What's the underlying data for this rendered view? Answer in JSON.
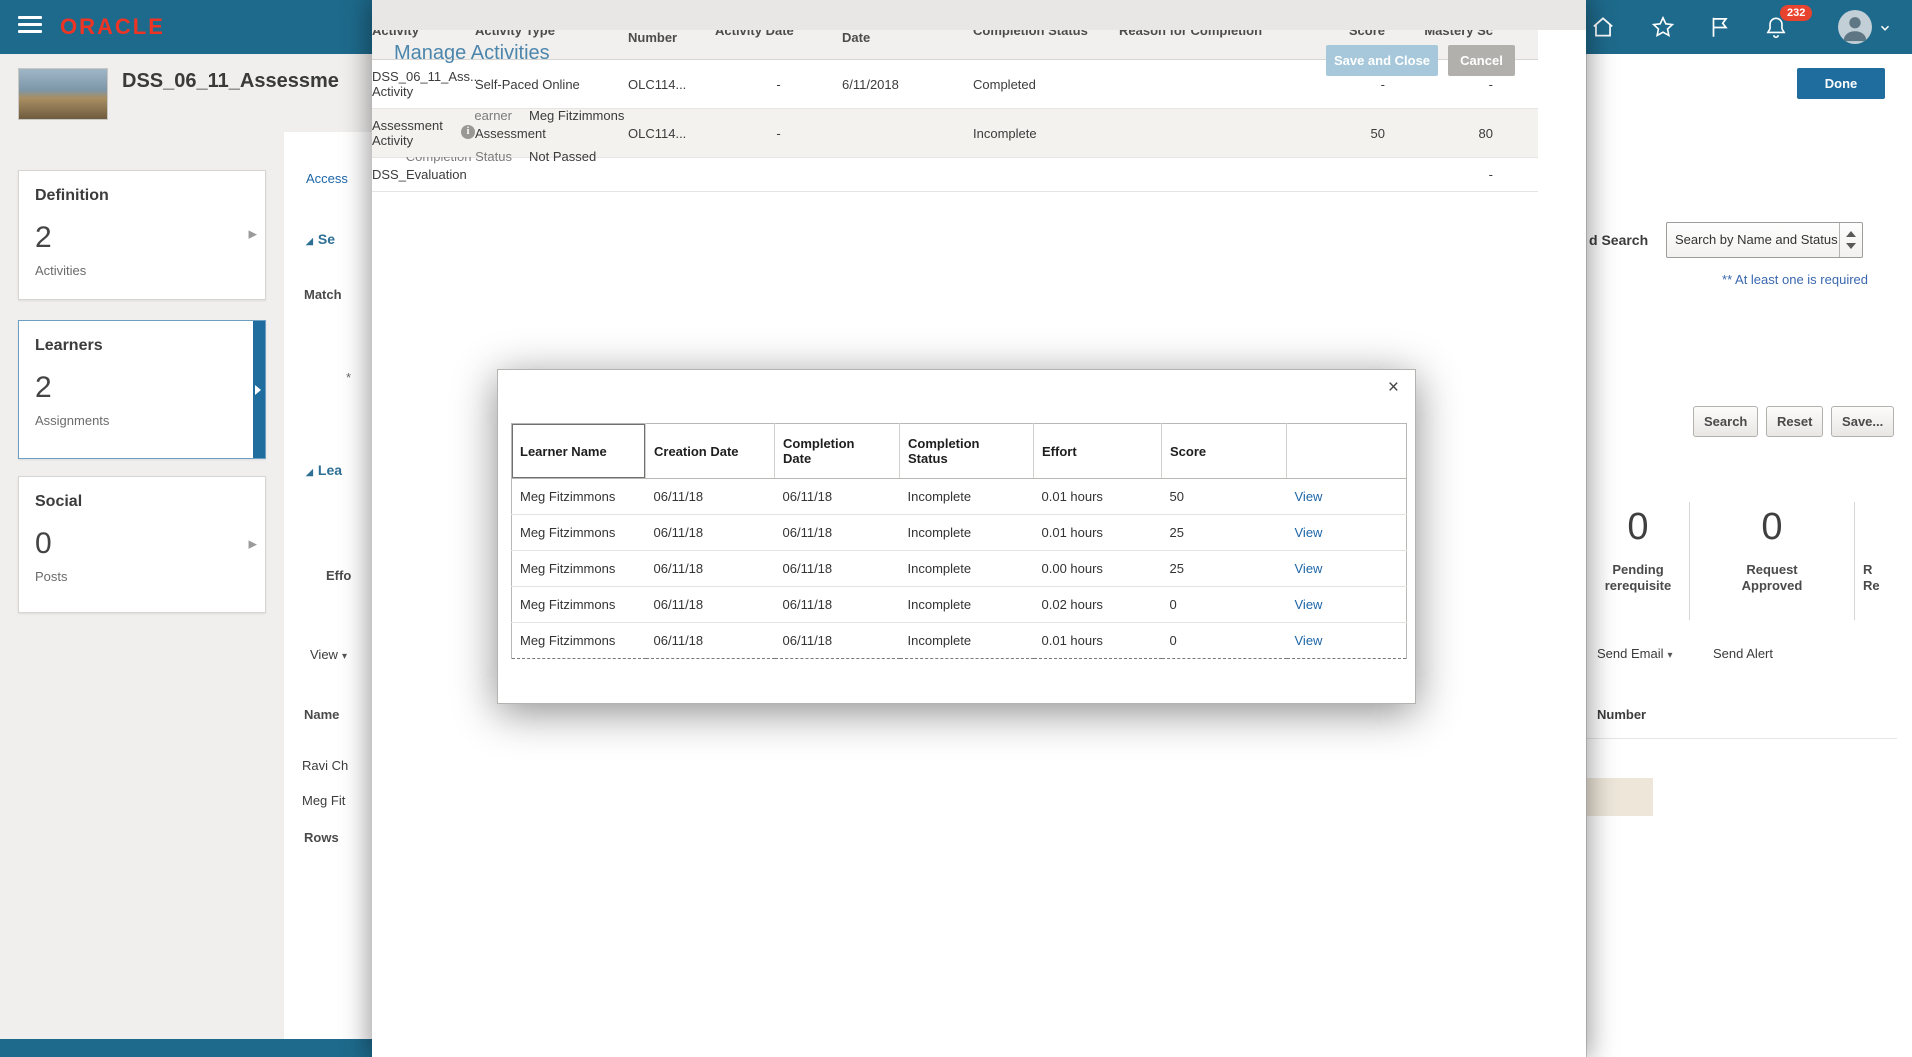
{
  "colors": {
    "topbar": "#1e6a8c",
    "brand_red": "#ee3424",
    "accent_blue": "#1e6d9e",
    "link_blue": "#1d66a7",
    "section_blue": "#2e6f94",
    "title_blue": "#4c86ac",
    "note_blue": "#3a68ad",
    "badge_red": "#e8432e",
    "save_disabled": "#a6c8da",
    "cancel_gray": "#b2b0ac"
  },
  "topbar": {
    "brand": "ORACLE",
    "badge_count": "232"
  },
  "page": {
    "title": "DSS_06_11_Assessme",
    "cards": [
      {
        "title": "Definition",
        "count": "2",
        "sublabel": "Activities"
      },
      {
        "title": "Learners",
        "count": "2",
        "sublabel": "Assignments"
      },
      {
        "title": "Social",
        "count": "0",
        "sublabel": "Posts"
      }
    ],
    "clipped": {
      "access": "Access",
      "section_a": "Se",
      "match": "Match",
      "asterisk": "*",
      "section_b": "Lea",
      "effort": "Effo",
      "view": "View",
      "name": "Name",
      "person_1": "Ravi Ch",
      "person_2": "Meg Fit",
      "rows": "Rows"
    }
  },
  "overlay": {
    "title": "Manage Activities",
    "save_button": "Save and Close",
    "cancel_button": "Cancel",
    "learner_label": "Learner",
    "learner_value": "Meg Fitzimmons",
    "status_label": "Completion Status",
    "status_value": "Not Passed",
    "table": {
      "columns": [
        "Activity",
        "Activity Type",
        "Activity Number",
        "Activity Date",
        "Completion Date",
        "Completion Status",
        "Reason for Completion",
        "Score",
        "Mastery Sc"
      ],
      "rows": [
        {
          "activity": [
            "DSS_06_11_Ass...",
            "Activity"
          ],
          "type": "Self-Paced Online",
          "number": "OLC114...",
          "activity_date": "-",
          "completion_date": "6/11/2018",
          "status": "Completed",
          "reason": "",
          "score": "-",
          "mastery": "-"
        },
        {
          "activity": [
            "Assessment",
            "Activity"
          ],
          "type": "Assessment",
          "number": "OLC114...",
          "activity_date": "-",
          "completion_date": "",
          "status": "Incomplete",
          "reason": "",
          "score": "50",
          "mastery": "80"
        },
        {
          "activity": [
            "DSS_Evaluation",
            ""
          ],
          "type": "",
          "number": "",
          "activity_date": "",
          "completion_date": "",
          "status": "",
          "reason": "",
          "score": "",
          "mastery": "-"
        }
      ]
    }
  },
  "modal": {
    "close_icon": "×",
    "table": {
      "columns": [
        "Learner Name",
        "Creation Date",
        "Completion Date",
        "Completion Status",
        "Effort",
        "Score"
      ],
      "rows": [
        {
          "learner": "Meg Fitzimmons",
          "creation": "06/11/18",
          "completion": "06/11/18",
          "status": "Incomplete",
          "effort": "0.01 hours",
          "score": "50",
          "action": "View"
        },
        {
          "learner": "Meg Fitzimmons",
          "creation": "06/11/18",
          "completion": "06/11/18",
          "status": "Incomplete",
          "effort": "0.01 hours",
          "score": "25",
          "action": "View"
        },
        {
          "learner": "Meg Fitzimmons",
          "creation": "06/11/18",
          "completion": "06/11/18",
          "status": "Incomplete",
          "effort": "0.00 hours",
          "score": "25",
          "action": "View"
        },
        {
          "learner": "Meg Fitzimmons",
          "creation": "06/11/18",
          "completion": "06/11/18",
          "status": "Incomplete",
          "effort": "0.02 hours",
          "score": "0",
          "action": "View"
        },
        {
          "learner": "Meg Fitzimmons",
          "creation": "06/11/18",
          "completion": "06/11/18",
          "status": "Incomplete",
          "effort": "0.01 hours",
          "score": "0",
          "action": "View"
        }
      ]
    }
  },
  "right_panel": {
    "done_button": "Done",
    "saved_search_label": "d Search",
    "search_dropdown_value": "Search by Name and Status",
    "required_note": "** At least one is required",
    "search_button": "Search",
    "reset_button": "Reset",
    "save_button": "Save...",
    "stats": [
      {
        "value": "0",
        "line1": "Pending",
        "line2": "rerequisite"
      },
      {
        "value": "0",
        "line1": "Request",
        "line2": "Approved"
      },
      {
        "value": "",
        "line1": "R",
        "line2": "Re"
      }
    ],
    "send_email": "Send Email",
    "send_alert": "Send Alert",
    "number_header": "Number"
  }
}
